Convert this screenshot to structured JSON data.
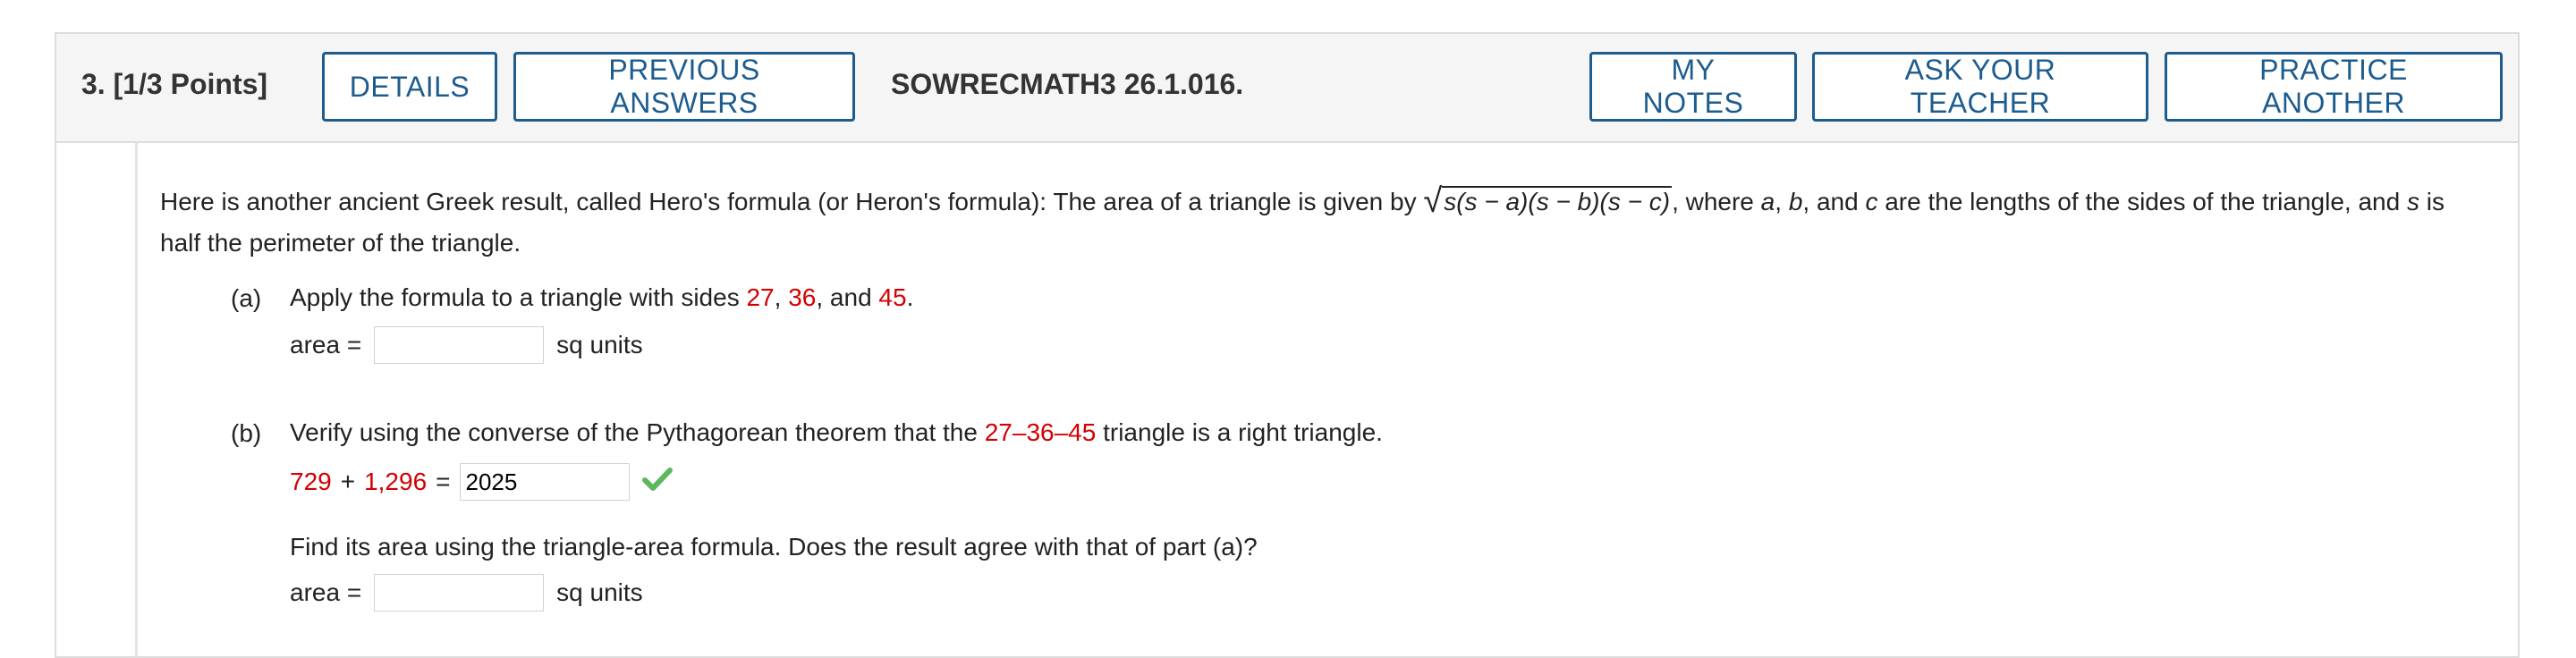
{
  "header": {
    "question_number": "3.",
    "points": "[1/3 Points]",
    "details_label": "DETAILS",
    "previous_answers_label": "PREVIOUS ANSWERS",
    "code": "SOWRECMATH3 26.1.016.",
    "my_notes_label": "MY NOTES",
    "ask_teacher_label": "ASK YOUR TEACHER",
    "practice_another_label": "PRACTICE ANOTHER"
  },
  "intro": {
    "text_before_formula": "Here is another ancient Greek result, called Hero's formula (or Heron's formula): The area of a triangle is given by ",
    "formula": "s(s − a)(s − b)(s − c)",
    "text_after_formula_1": ", where ",
    "var_a": "a",
    "sep1": ", ",
    "var_b": "b",
    "sep2": ", and ",
    "var_c": "c",
    "text_after_vars": " are the lengths of the sides of the triangle, and ",
    "var_s": "s",
    "text_end": " is half the perimeter of the triangle."
  },
  "part_a": {
    "label": "(a)",
    "prompt_start": "Apply the formula to a triangle with sides ",
    "side1": "27",
    "comma1": ", ",
    "side2": "36",
    "comma2": ", and ",
    "side3": "45",
    "period": ".",
    "area_label": "area =",
    "area_value": "",
    "units": "sq units"
  },
  "part_b": {
    "label": "(b)",
    "prompt_start": "Verify using the converse of the Pythagorean theorem that the ",
    "t1": "27",
    "dash1": "–",
    "t2": "36",
    "dash2": "–",
    "t3": "45",
    "prompt_end": " triangle is a right triangle.",
    "sum_term1": "729",
    "plus": "+",
    "sum_term2": "1,296",
    "equals": "=",
    "sum_value": "2025",
    "find_text": "Find its area using the triangle-area formula. Does the result agree with that of part (a)?",
    "area_label": "area =",
    "area_value": "",
    "units": "sq units"
  },
  "colors": {
    "accent": "#1d5c8f",
    "highlight": "#d40000",
    "check": "#5cb85c"
  }
}
